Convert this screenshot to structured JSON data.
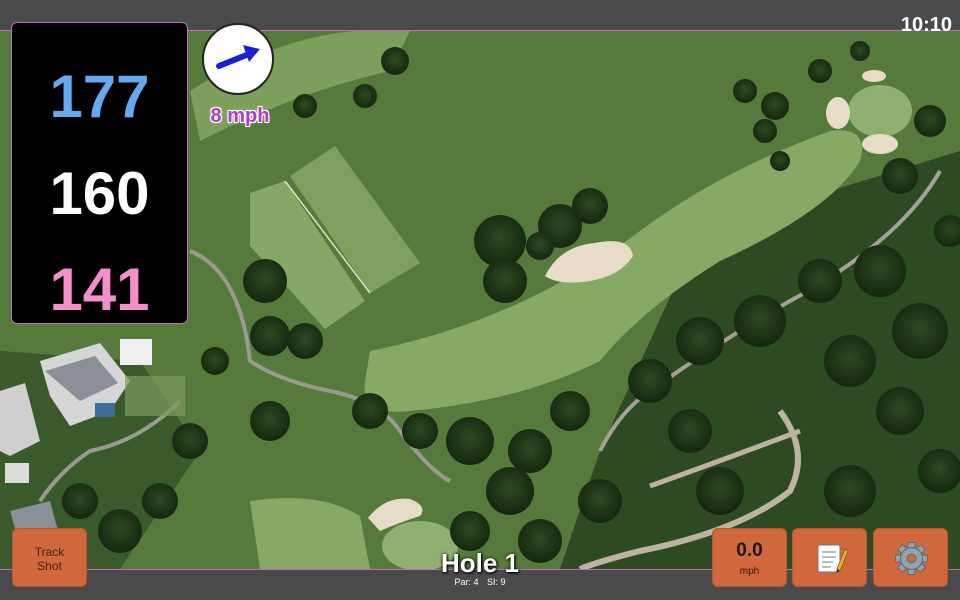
{
  "status": {
    "time": "10:10"
  },
  "distances": {
    "back": "177",
    "middle": "160",
    "front": "141"
  },
  "wind": {
    "speed": "8 mph",
    "direction_icon": "arrow-icon"
  },
  "hole": {
    "title": "Hole 1",
    "par": "Par: 4",
    "si": "SI: 9"
  },
  "buttons": {
    "track_shot": "Track\nShot",
    "speed_value": "0.0",
    "speed_unit": "mph",
    "notes_icon": "notepad-icon",
    "settings_icon": "gear-icon"
  },
  "colors": {
    "back_distance": "#63aaf0",
    "middle_distance": "#ffffff",
    "front_distance": "#f58fcc",
    "wind_text": "#b03cc0",
    "button": "#d1683c"
  }
}
